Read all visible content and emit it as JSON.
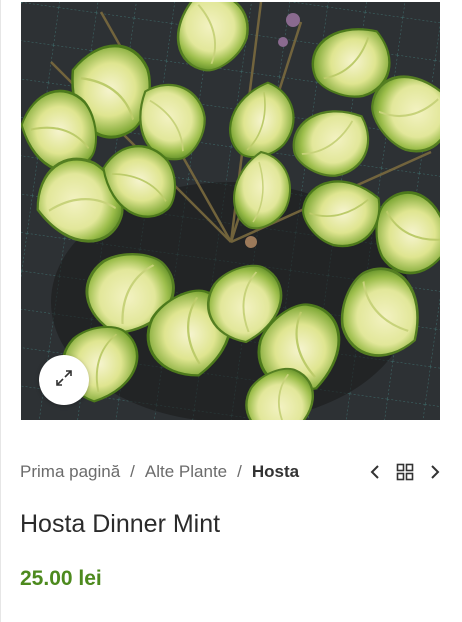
{
  "product_image": {
    "alt": "Hosta Dinner Mint"
  },
  "zoom": {
    "icon": "expand-icon"
  },
  "breadcrumb": {
    "home": "Prima pagină",
    "separator": "/",
    "category": "Alte Plante",
    "current": "Hosta"
  },
  "product_nav": {
    "prev_icon": "chevron-left-icon",
    "grid_icon": "grid-icon",
    "next_icon": "chevron-right-icon"
  },
  "product": {
    "title": "Hosta Dinner Mint",
    "price": "25.00 lei"
  },
  "colors": {
    "price": "#4d8a1e",
    "title": "#2b2b2b",
    "breadcrumb": "#6b6b6b",
    "leaf_center": "#eef0b0",
    "leaf_edge": "#6e9a2c"
  }
}
